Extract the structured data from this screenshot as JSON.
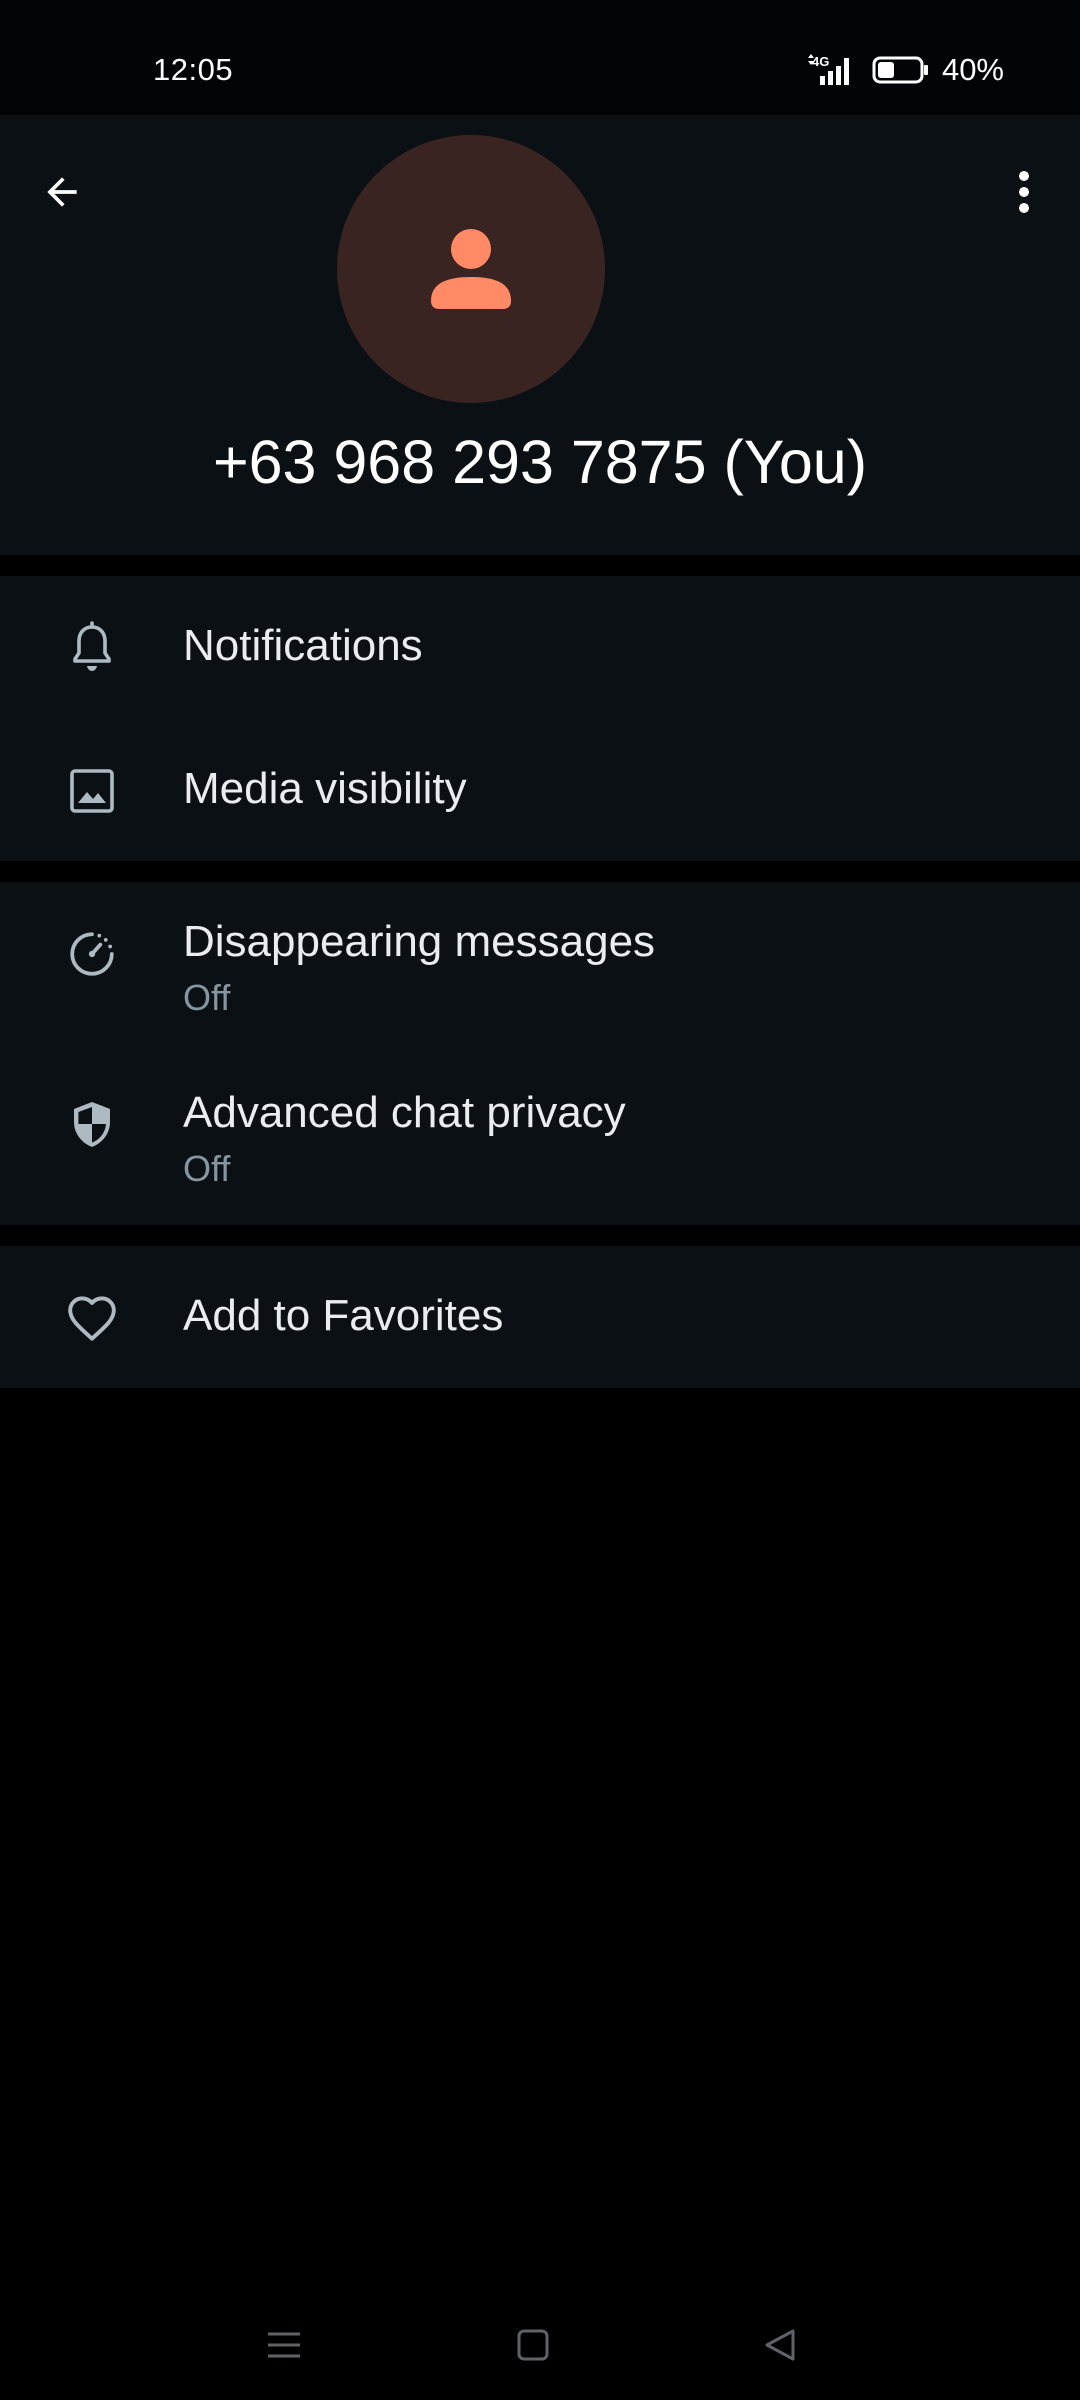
{
  "status_bar": {
    "time": "12:05",
    "network": "4G",
    "battery": "40%",
    "battery_level": 0.4
  },
  "header": {
    "name": "+63 968 293 7875 (You)",
    "avatar_icon": "person-icon",
    "avatar_color": "#ff8a65"
  },
  "settings": {
    "notifications": "Notifications",
    "media_visibility": "Media visibility",
    "disappearing_messages": "Disappearing messages",
    "disappearing_messages_value": "Off",
    "advanced_chat_privacy": "Advanced chat privacy",
    "advanced_chat_privacy_value": "Off",
    "add_to_favorites": "Add to Favorites"
  },
  "colors": {
    "background": "#000000",
    "surface": "#0b1014",
    "text_primary": "#e9edef",
    "text_secondary": "#8696a0",
    "icon": "#aebac1"
  }
}
